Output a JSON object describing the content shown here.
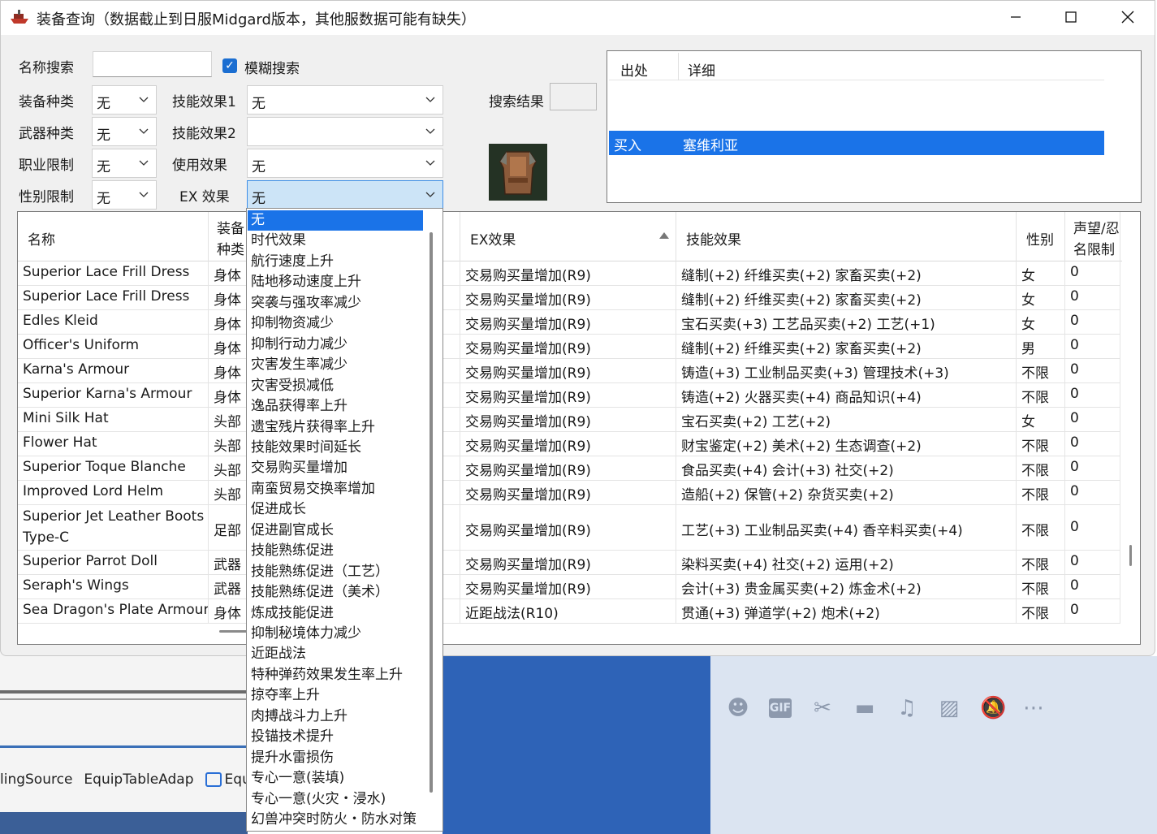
{
  "window": {
    "title": "装备查询（数据截止到日服Midgard版本，其他服数据可能有缺失）",
    "minimize": "—",
    "maximize": "☐",
    "close": "✕"
  },
  "search": {
    "name_label": "名称搜索",
    "name_value": "",
    "fuzzy_label": "模糊搜索",
    "fuzzy_checked": true,
    "equip_type_label": "装备种类",
    "equip_type_value": "无",
    "weapon_type_label": "武器种类",
    "weapon_type_value": "无",
    "job_label": "职业限制",
    "job_value": "无",
    "gender_label": "性别限制",
    "gender_value": "无",
    "skill1_label": "技能效果1",
    "skill1_value": "无",
    "skill2_label": "技能效果2",
    "skill2_value": "",
    "use_label": "使用效果",
    "use_value": "无",
    "ex_label": "EX 效果",
    "ex_value": "无",
    "result_label": "搜索结果"
  },
  "source_list": {
    "headers": [
      "出处",
      "详细"
    ],
    "rows": [
      {
        "source": "买入",
        "detail": "塞维利亚"
      }
    ]
  },
  "table": {
    "headers": {
      "name": "名称",
      "type_line1": "装备",
      "type_line2": "种类",
      "ex": "EX效果",
      "skill": "技能效果",
      "gender": "性别",
      "fame_line1": "声望/忍",
      "fame_line2": "名限制"
    },
    "rows": [
      {
        "name": "Superior Lace Frill Dress",
        "type": "身体",
        "ex": "交易购买量增加(R9)",
        "skill": "缝制(+2) 纤维买卖(+2) 家畜买卖(+2)",
        "gender": "女",
        "fame": "0"
      },
      {
        "name": "Superior Lace Frill Dress",
        "type": "身体",
        "ex": "交易购买量增加(R9)",
        "skill": "缝制(+2) 纤维买卖(+2) 家畜买卖(+2)",
        "gender": "女",
        "fame": "0"
      },
      {
        "name": "Edles Kleid",
        "type": "身体",
        "ex": "交易购买量增加(R9)",
        "skill": "宝石买卖(+3) 工艺品买卖(+2) 工艺(+1)",
        "gender": "女",
        "fame": "0"
      },
      {
        "name": "Officer's Uniform",
        "type": "身体",
        "ex": "交易购买量增加(R9)",
        "skill": "缝制(+2) 纤维买卖(+2) 家畜买卖(+2)",
        "gender": "男",
        "fame": "0"
      },
      {
        "name": "Karna's Armour",
        "type": "身体",
        "ex": "交易购买量增加(R9)",
        "skill": "铸造(+3) 工业制品买卖(+3) 管理技术(+3)",
        "gender": "不限",
        "fame": "0"
      },
      {
        "name": "Superior Karna's Armour",
        "type": "身体",
        "ex": "交易购买量增加(R9)",
        "skill": "铸造(+2) 火器买卖(+4) 商品知识(+4)",
        "gender": "不限",
        "fame": "0"
      },
      {
        "name": "Mini Silk Hat",
        "type": "头部",
        "ex": "交易购买量增加(R9)",
        "skill": "宝石买卖(+2) 工艺(+2)",
        "gender": "女",
        "fame": "0"
      },
      {
        "name": "Flower Hat",
        "type": "头部",
        "ex": "交易购买量增加(R9)",
        "skill": "财宝鉴定(+2) 美术(+2) 生态调查(+2)",
        "gender": "不限",
        "fame": "0"
      },
      {
        "name": "Superior Toque Blanche",
        "type": "头部",
        "ex": "交易购买量增加(R9)",
        "skill": "食品买卖(+4) 会计(+3) 社交(+2)",
        "gender": "不限",
        "fame": "0"
      },
      {
        "name": "Improved Lord Helm",
        "type": "头部",
        "ex": "交易购买量增加(R9)",
        "skill": "造船(+2) 保管(+2) 杂货买卖(+2)",
        "gender": "不限",
        "fame": "0"
      },
      {
        "name": "Superior Jet Leather Boots",
        "name2": "Type-C",
        "type": "足部",
        "ex": "交易购买量增加(R9)",
        "skill": "工艺(+3) 工业制品买卖(+4) 香辛料买卖(+4)",
        "gender": "不限",
        "fame": "0"
      },
      {
        "name": "Superior Parrot Doll",
        "type": "武器",
        "ex": "交易购买量增加(R9)",
        "skill": "染料买卖(+4) 社交(+2) 运用(+2)",
        "gender": "不限",
        "fame": "0"
      },
      {
        "name": "Seraph's Wings",
        "type": "武器",
        "ex": "交易购买量增加(R9)",
        "skill": "会计(+3) 贵金属买卖(+2) 炼金术(+2)",
        "gender": "不限",
        "fame": "0"
      },
      {
        "name": "Sea Dragon's Plate Armour",
        "type": "身体",
        "ex": "近距战法(R10)",
        "skill": "贯通(+3) 弹道学(+2) 炮术(+2)",
        "gender": "不限",
        "fame": "0"
      }
    ]
  },
  "ex_dropdown": {
    "selected_index": 0,
    "options": [
      "无",
      "时代效果",
      "航行速度上升",
      "陆地移动速度上升",
      "突袭与强攻率减少",
      "抑制物资减少",
      "抑制行动力减少",
      "灾害发生率减少",
      "灾害受损减低",
      "逸品获得率上升",
      "遗宝残片获得率上升",
      "技能效果时间延长",
      "交易购买量增加",
      "南蛮贸易交换率增加",
      "促进成长",
      "促进副官成长",
      "技能熟练促进",
      "技能熟练促进（工艺）",
      "技能熟练促进（美术）",
      "炼成技能促进",
      "抑制秘境体力减少",
      "近距战法",
      "特种弹药效果发生率上升",
      "掠夺率上升",
      "肉搏战斗力上升",
      "投锚技术提升",
      "提升水雷损伤",
      "专心一意(装填)",
      "专心一意(火灾・浸水)",
      "幻兽冲突时防火・防水对策"
    ]
  },
  "background": {
    "tabs": [
      "lingSource",
      "EquipTableAdap",
      "Equip"
    ]
  },
  "colors": {
    "selection": "#1a73e8",
    "window_bg": "#f0f0f0",
    "combo_active": "#cce4f7",
    "taskbar_blue": "#2e63b7"
  }
}
